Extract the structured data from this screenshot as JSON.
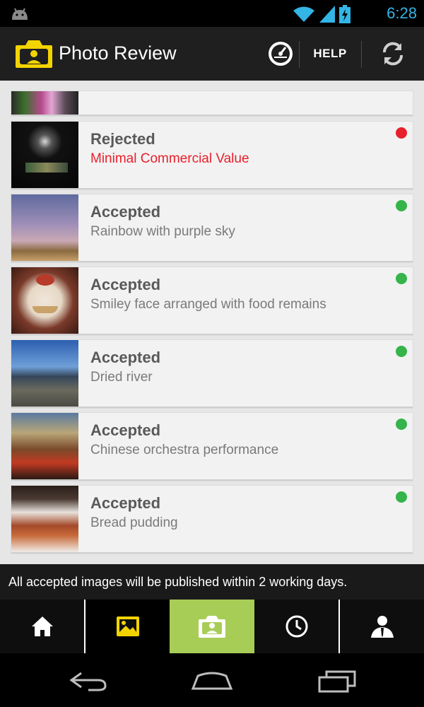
{
  "status_bar": {
    "time": "6:28",
    "icons": [
      "android-icon",
      "wifi-icon",
      "signal-icon",
      "battery-icon"
    ]
  },
  "action_bar": {
    "title": "Photo Review",
    "help_label": "HELP",
    "icons": [
      "camera-logo-icon",
      "gauge-icon",
      "refresh-icon"
    ]
  },
  "reviews": [
    {
      "status": "",
      "description": "",
      "dot": ""
    },
    {
      "status": "Rejected",
      "description": "Minimal Commercial Value",
      "dot": "#e8202c"
    },
    {
      "status": "Accepted",
      "description": "Rainbow with purple sky",
      "dot": "#34b44a"
    },
    {
      "status": "Accepted",
      "description": "Smiley face arranged with food remains",
      "dot": "#34b44a"
    },
    {
      "status": "Accepted",
      "description": "Dried river",
      "dot": "#34b44a"
    },
    {
      "status": "Accepted",
      "description": "Chinese orchestra performance",
      "dot": "#34b44a"
    },
    {
      "status": "Accepted",
      "description": "Bread pudding",
      "dot": "#34b44a"
    }
  ],
  "colors": {
    "accent_yellow": "#f4d400",
    "active_tab": "#a8cd56",
    "rejected": "#e8202c",
    "accepted": "#34b44a",
    "time_blue": "#33b5e5"
  },
  "footer": {
    "note": "All accepted images will be published within 2 working days."
  },
  "tabs": [
    {
      "name": "home-icon",
      "state": "normal"
    },
    {
      "name": "gallery-icon",
      "state": "selected"
    },
    {
      "name": "review-icon",
      "state": "active"
    },
    {
      "name": "history-icon",
      "state": "normal"
    },
    {
      "name": "profile-icon",
      "state": "normal"
    }
  ],
  "nav_bar": [
    "back-icon",
    "home-nav-icon",
    "recents-icon"
  ]
}
